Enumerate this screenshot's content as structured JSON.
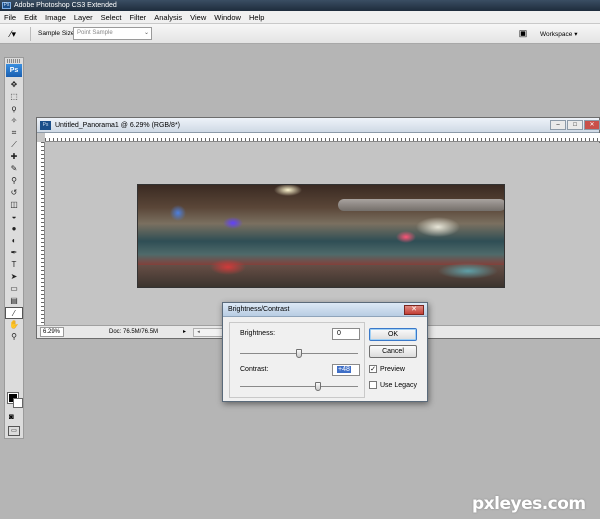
{
  "app": {
    "title": "Adobe Photoshop CS3 Extended",
    "ps_mark": "Ps"
  },
  "menu": [
    "File",
    "Edit",
    "Image",
    "Layer",
    "Select",
    "Filter",
    "Analysis",
    "View",
    "Window",
    "Help"
  ],
  "options_bar": {
    "sample_size_label": "Sample Size:",
    "sample_size_value": "Point Sample",
    "workspace_label": "Workspace ▾"
  },
  "document": {
    "title": "Untitled_Panorama1 @ 6.29% (RGB/8*)",
    "zoom": "6.29%",
    "doc_size": "Doc: 76.5M/76.5M",
    "ps_mark": "Ps"
  },
  "dialog": {
    "title": "Brightness/Contrast",
    "brightness_label": "Brightness:",
    "brightness_value": "0",
    "contrast_label": "Contrast:",
    "contrast_value": "+48",
    "ok_label": "OK",
    "cancel_label": "Cancel",
    "preview_label": "Preview",
    "preview_checked": true,
    "legacy_label": "Use Legacy",
    "legacy_checked": false,
    "brightness_slider_fraction": 0.5,
    "contrast_slider_fraction": 0.66
  },
  "watermark": "pxleyes.com",
  "colors": {
    "foreground": "#000000",
    "background": "#ffffff",
    "titlebar": "#2a3a4c",
    "workspace_bg": "#b5b5b5"
  }
}
